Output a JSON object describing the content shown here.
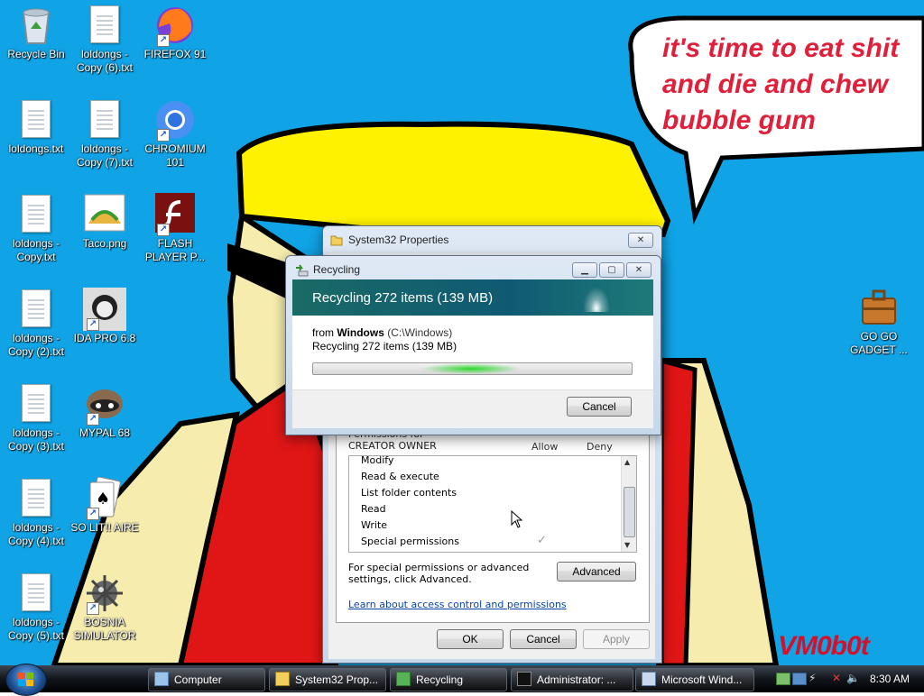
{
  "desktop": {
    "background_color": "#10a3e5",
    "speech_lines": [
      "it's time to eat shit",
      "and die and chew",
      "bubble gum"
    ],
    "signature": "VM0b0t",
    "icons": [
      {
        "name": "recycle-bin-icon",
        "label": "Recycle Bin"
      },
      {
        "name": "text-file-icon",
        "label": "loldongs - Copy (6).txt"
      },
      {
        "name": "firefox-icon",
        "label": "FIREFOX 91"
      },
      {
        "name": "text-file-icon",
        "label": "loldongs.txt"
      },
      {
        "name": "text-file-icon",
        "label": "loldongs - Copy (7).txt"
      },
      {
        "name": "chromium-icon",
        "label": "CHROMIUM 101"
      },
      {
        "name": "text-file-icon",
        "label": "loldongs - Copy.txt"
      },
      {
        "name": "image-file-icon",
        "label": "Taco.png"
      },
      {
        "name": "flash-player-icon",
        "label": "FLASH PLAYER P..."
      },
      {
        "name": "text-file-icon",
        "label": "loldongs - Copy (2).txt"
      },
      {
        "name": "ida-pro-icon",
        "label": "IDA PRO 6.8"
      },
      {
        "name": "gadget-briefcase-icon",
        "label": "GO GO GADGET ..."
      },
      {
        "name": "text-file-icon",
        "label": "loldongs - Copy (3).txt"
      },
      {
        "name": "raccoon-icon",
        "label": "MYPAL 68"
      },
      {
        "name": "text-file-icon",
        "label": "loldongs - Copy (4).txt"
      },
      {
        "name": "solitaire-icon",
        "label": "SO LIT!! AIRE"
      },
      {
        "name": "text-file-icon",
        "label": "loldongs - Copy (5).txt"
      },
      {
        "name": "mine-icon",
        "label": "BOSNIA SIMULATOR"
      }
    ]
  },
  "properties_window": {
    "title": "System32 Properties",
    "permissions_header": "Permissions for CREATOR OWNER",
    "col_allow": "Allow",
    "col_deny": "Deny",
    "permissions": [
      {
        "label": "Modify",
        "allow": false
      },
      {
        "label": "Read & execute",
        "allow": false
      },
      {
        "label": "List folder contents",
        "allow": false
      },
      {
        "label": "Read",
        "allow": false
      },
      {
        "label": "Write",
        "allow": false
      },
      {
        "label": "Special permissions",
        "allow": true
      }
    ],
    "special_text": "For special permissions or advanced settings, click Advanced.",
    "advanced_label": "Advanced",
    "link": "Learn about access control and permissions",
    "ok_label": "OK",
    "cancel_label": "Cancel",
    "apply_label": "Apply"
  },
  "recycling_dialog": {
    "title": "Recycling",
    "header": "Recycling 272 items (139 MB)",
    "from_prefix": "from",
    "from_name": "Windows",
    "from_path": "(C:\\Windows)",
    "status": "Recycling 272 items (139 MB)",
    "cancel_label": "Cancel",
    "accent_color": "#1c6f6c"
  },
  "taskbar": {
    "items": [
      {
        "name": "computer",
        "label": "Computer"
      },
      {
        "name": "system32-properties",
        "label": "System32 Prop..."
      },
      {
        "name": "recycling",
        "label": "Recycling"
      },
      {
        "name": "admin-cmd",
        "label": "Administrator: ..."
      },
      {
        "name": "microsoft-word",
        "label": "Microsoft Wind..."
      }
    ],
    "time": "8:30 AM"
  }
}
